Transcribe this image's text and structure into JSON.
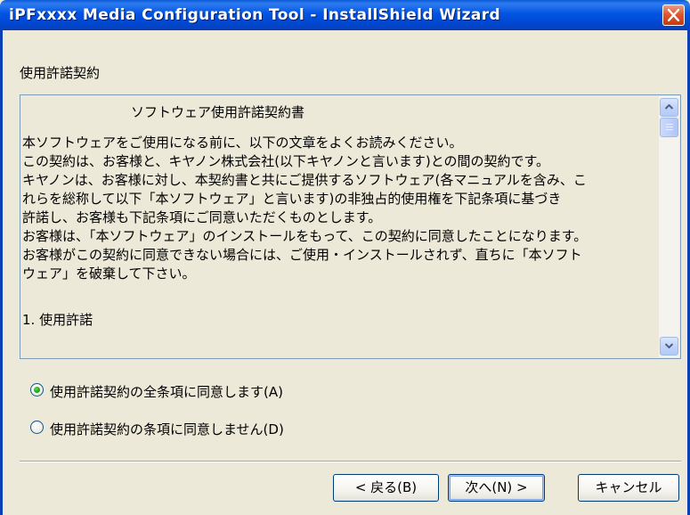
{
  "window": {
    "title": "iPFxxxx Media Configuration Tool - InstallShield Wizard"
  },
  "section": {
    "label": "使用許諾契約"
  },
  "license": {
    "heading": "ソフトウェア使用許諾契約書",
    "lines": [
      "本ソフトウェアをご使用になる前に、以下の文章をよくお読みください。",
      "この契約は、お客様と、キヤノン株式会社(以下キヤノンと言います)との間の契約です。",
      "キヤノンは、お客様に対し、本契約書と共にご提供するソフトウェア(各マニュアルを含み、こ",
      "れらを総称して以下「本ソフトウェア」と言います)の非独占的使用権を下記条項に基づき",
      "許諾し、お客様も下記条項にご同意いただくものとします。",
      "お客様は、「本ソフトウェア」のインストールをもって、この契約に同意したことになります。",
      "お客様がこの契約に同意できない場合には、ご使用・インストールされず、直ちに「本ソフト",
      "ウェア」を破棄して下さい。",
      "",
      "1. 使用許諾"
    ]
  },
  "options": {
    "accept_label": "使用許諾契約の全条項に同意します(A)",
    "decline_label": "使用許諾契約の条項に同意しません(D)",
    "selected": "accept"
  },
  "buttons": {
    "back": "< 戻る(B)",
    "next": "次へ(N) >",
    "cancel": "キャンセル"
  },
  "colors": {
    "titlebar": "#0054e3",
    "dialog_bg": "#ece9d8",
    "close_button": "#e0572f",
    "radio_selected": "#21a121"
  },
  "icons": {
    "close": "close-icon",
    "scroll_up": "chevron-up-icon",
    "scroll_down": "chevron-down-icon"
  }
}
